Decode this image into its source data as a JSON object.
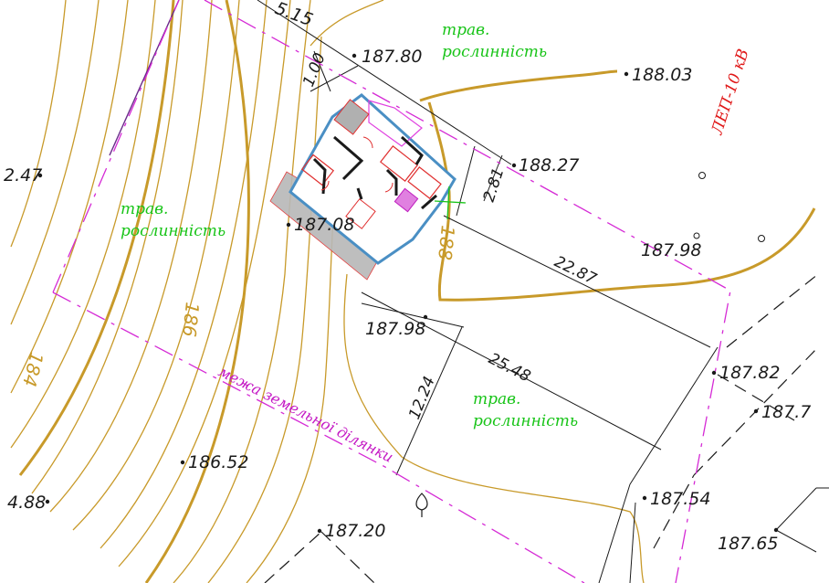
{
  "map": {
    "elevations": [
      {
        "id": "elev-187-80",
        "text": "187.80"
      },
      {
        "id": "elev-188-03",
        "text": "188.03"
      },
      {
        "id": "elev-188-27",
        "text": "188.27"
      },
      {
        "id": "elev-187-98-right",
        "text": "187.98"
      },
      {
        "id": "elev-187-08",
        "text": "187.08"
      },
      {
        "id": "elev-187-98-mid",
        "text": "187.98"
      },
      {
        "id": "elev-187-82",
        "text": "187.82"
      },
      {
        "id": "elev-187-7",
        "text": "187.7"
      },
      {
        "id": "elev-186-52",
        "text": "186.52"
      },
      {
        "id": "elev-187-54",
        "text": "187.54"
      },
      {
        "id": "elev-187-20",
        "text": "187.20"
      },
      {
        "id": "elev-187-65",
        "text": "187.65"
      },
      {
        "id": "elev-left-47",
        "text": "2.47"
      },
      {
        "id": "elev-left-88",
        "text": "4.88"
      },
      {
        "id": "elev-top-15",
        "text": "5.15"
      }
    ],
    "dimensions": {
      "d_1_00": "1.00",
      "d_2_81": "2.81",
      "d_22_87": "22.87",
      "d_25_48": "25.48",
      "d_12_24": "12.24"
    },
    "vegetation_label": [
      "трав.",
      "рослинність"
    ],
    "power_line_label": "ЛЕП-10 кВ",
    "boundary_label": "межа земельної ділянки",
    "contour_labels": {
      "c186": "186",
      "c184": "184",
      "c188": "188"
    },
    "colors": {
      "contour": "#c89a2a",
      "boundary": "#d52ad5",
      "vegetation_text": "#18c418",
      "power_line_text": "#e01818",
      "building_wall": "#4a8fc4",
      "dimension_line": "#1a1a1a"
    }
  }
}
